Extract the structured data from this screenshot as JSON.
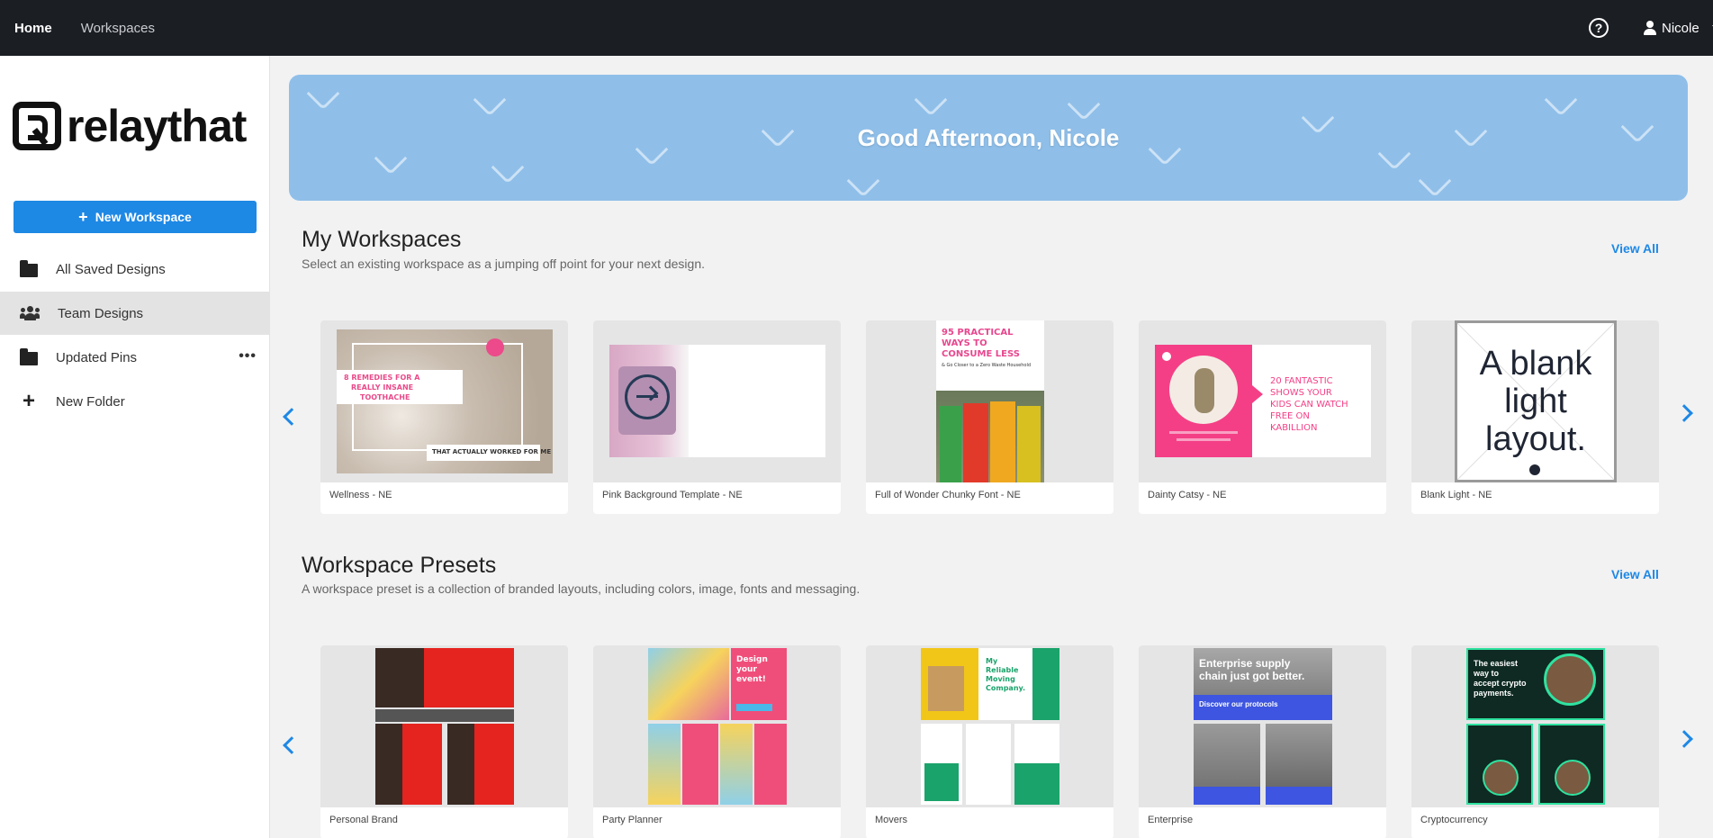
{
  "topbar": {
    "nav": [
      {
        "label": "Home"
      },
      {
        "label": "Workspaces"
      }
    ],
    "user_name": "Nicole",
    "help_glyph": "?"
  },
  "sidebar": {
    "logo_text": "relaythat",
    "new_workspace_label": "New Workspace",
    "items": [
      {
        "label": "All Saved Designs",
        "icon": "folder-icon"
      },
      {
        "label": "Team Designs",
        "icon": "team-icon",
        "active": true
      },
      {
        "label": "Updated Pins",
        "icon": "folder-icon",
        "more": "•••"
      },
      {
        "label": "New Folder",
        "icon": "plus-icon"
      }
    ]
  },
  "banner": {
    "greeting": "Good Afternoon, Nicole"
  },
  "my_workspaces": {
    "title": "My Workspaces",
    "subtitle": "Select an existing workspace as a jumping off point for your next design.",
    "view_all": "View All",
    "cards": [
      {
        "label": "Wellness - NE",
        "thumb_text": [
          "8 REMEDIES FOR A",
          "REALLY INSANE",
          "TOOTHACHE",
          "THAT ACTUALLY WORKED FOR ME"
        ]
      },
      {
        "label": "Pink Background Template - NE"
      },
      {
        "label": "Full of Wonder Chunky Font - NE",
        "thumb_text": [
          "95 PRACTICAL",
          "WAYS TO",
          "CONSUME LESS",
          "& Go Closer to a Zero Waste Household"
        ]
      },
      {
        "label": "Dainty Catsy - NE",
        "thumb_text": [
          "20 FANTASTIC",
          "SHOWS YOUR",
          "KIDS CAN WATCH",
          "FREE ON",
          "KABILLION"
        ]
      },
      {
        "label": "Blank Light - NE",
        "thumb_text": [
          "A blank",
          "light",
          "layout."
        ]
      }
    ]
  },
  "presets": {
    "title": "Workspace Presets",
    "subtitle": "A workspace preset is a collection of branded layouts, including colors, image, fonts and messaging.",
    "view_all": "View All",
    "cards": [
      {
        "label": "Personal Brand"
      },
      {
        "label": "Party Planner",
        "thumb_text": [
          "Design",
          "your",
          "event!"
        ]
      },
      {
        "label": "Movers",
        "thumb_text": [
          "My",
          "Reliable",
          "Moving",
          "Company."
        ]
      },
      {
        "label": "Enterprise",
        "thumb_text": [
          "Enterprise supply",
          "chain just got better.",
          "Discover our protocols"
        ]
      },
      {
        "label": "Cryptocurrency",
        "thumb_text": [
          "The easiest",
          "way to",
          "accept crypto",
          "payments."
        ]
      }
    ]
  },
  "colors": {
    "accent": "#1e88e5",
    "topbar": "#1b1e23",
    "banner": "#8fbfe9"
  }
}
